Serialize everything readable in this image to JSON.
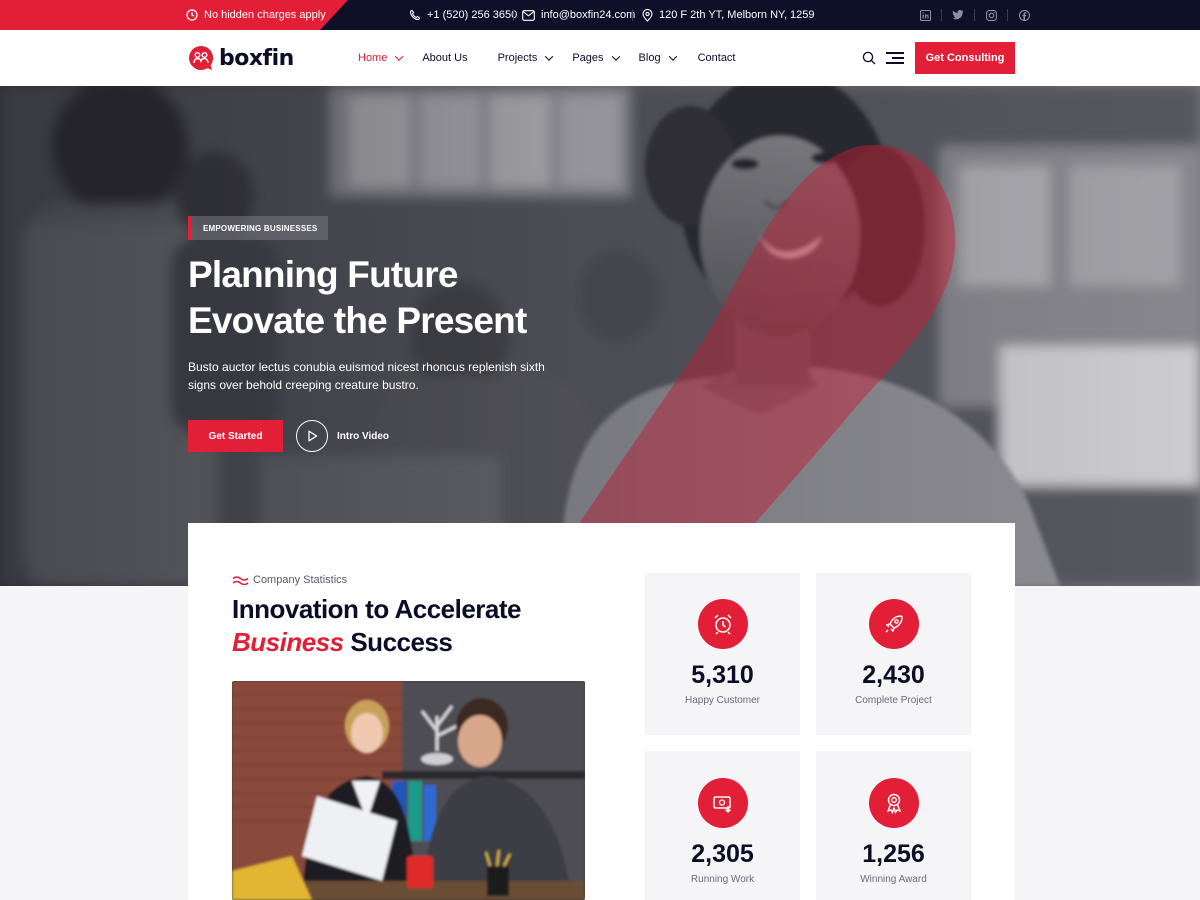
{
  "colors": {
    "accent": "#e31e37",
    "dark": "#0d1028",
    "light_bg": "#f5f5f7"
  },
  "topbar": {
    "notice": "No hidden charges apply",
    "phone": "+1 (520) 256 3650",
    "email": "info@boxfin24.com",
    "address": "120 F 2th YT, Melborn NY, 1259",
    "social_icons": [
      "linkedin-icon",
      "twitter-icon",
      "instagram-icon",
      "facebook-icon"
    ]
  },
  "header": {
    "brand": "boxfin",
    "nav": [
      {
        "label": "Home",
        "dropdown": true,
        "active": true
      },
      {
        "label": "About Us",
        "dropdown": false
      },
      {
        "label": "Projects",
        "dropdown": true
      },
      {
        "label": "Pages",
        "dropdown": true
      },
      {
        "label": "Blog",
        "dropdown": true
      },
      {
        "label": "Contact",
        "dropdown": false
      }
    ],
    "cta": "Get Consulting"
  },
  "hero": {
    "tag": "EMPOWERING BUSINESSES",
    "title_line1": "Planning Future",
    "title_line2": "Evovate the Present",
    "description": "Busto auctor lectus conubia euismod nicest rhoncus replenish sixth signs over behold creeping creature bustro.",
    "primary_button": "Get Started",
    "video_button": "Intro Video"
  },
  "stats_section": {
    "eyebrow": "Company Statistics",
    "title_line1": "Innovation to Accelerate",
    "title_highlight": "Business",
    "title_rest": "Success",
    "stats": [
      {
        "value": "5,310",
        "label": "Happy Customer",
        "icon": "alarm-clock-icon"
      },
      {
        "value": "2,430",
        "label": "Complete Project",
        "icon": "rocket-icon"
      },
      {
        "value": "2,305",
        "label": "Running Work",
        "icon": "money-transfer-icon"
      },
      {
        "value": "1,256",
        "label": "Winning Award",
        "icon": "award-medal-icon"
      }
    ]
  }
}
